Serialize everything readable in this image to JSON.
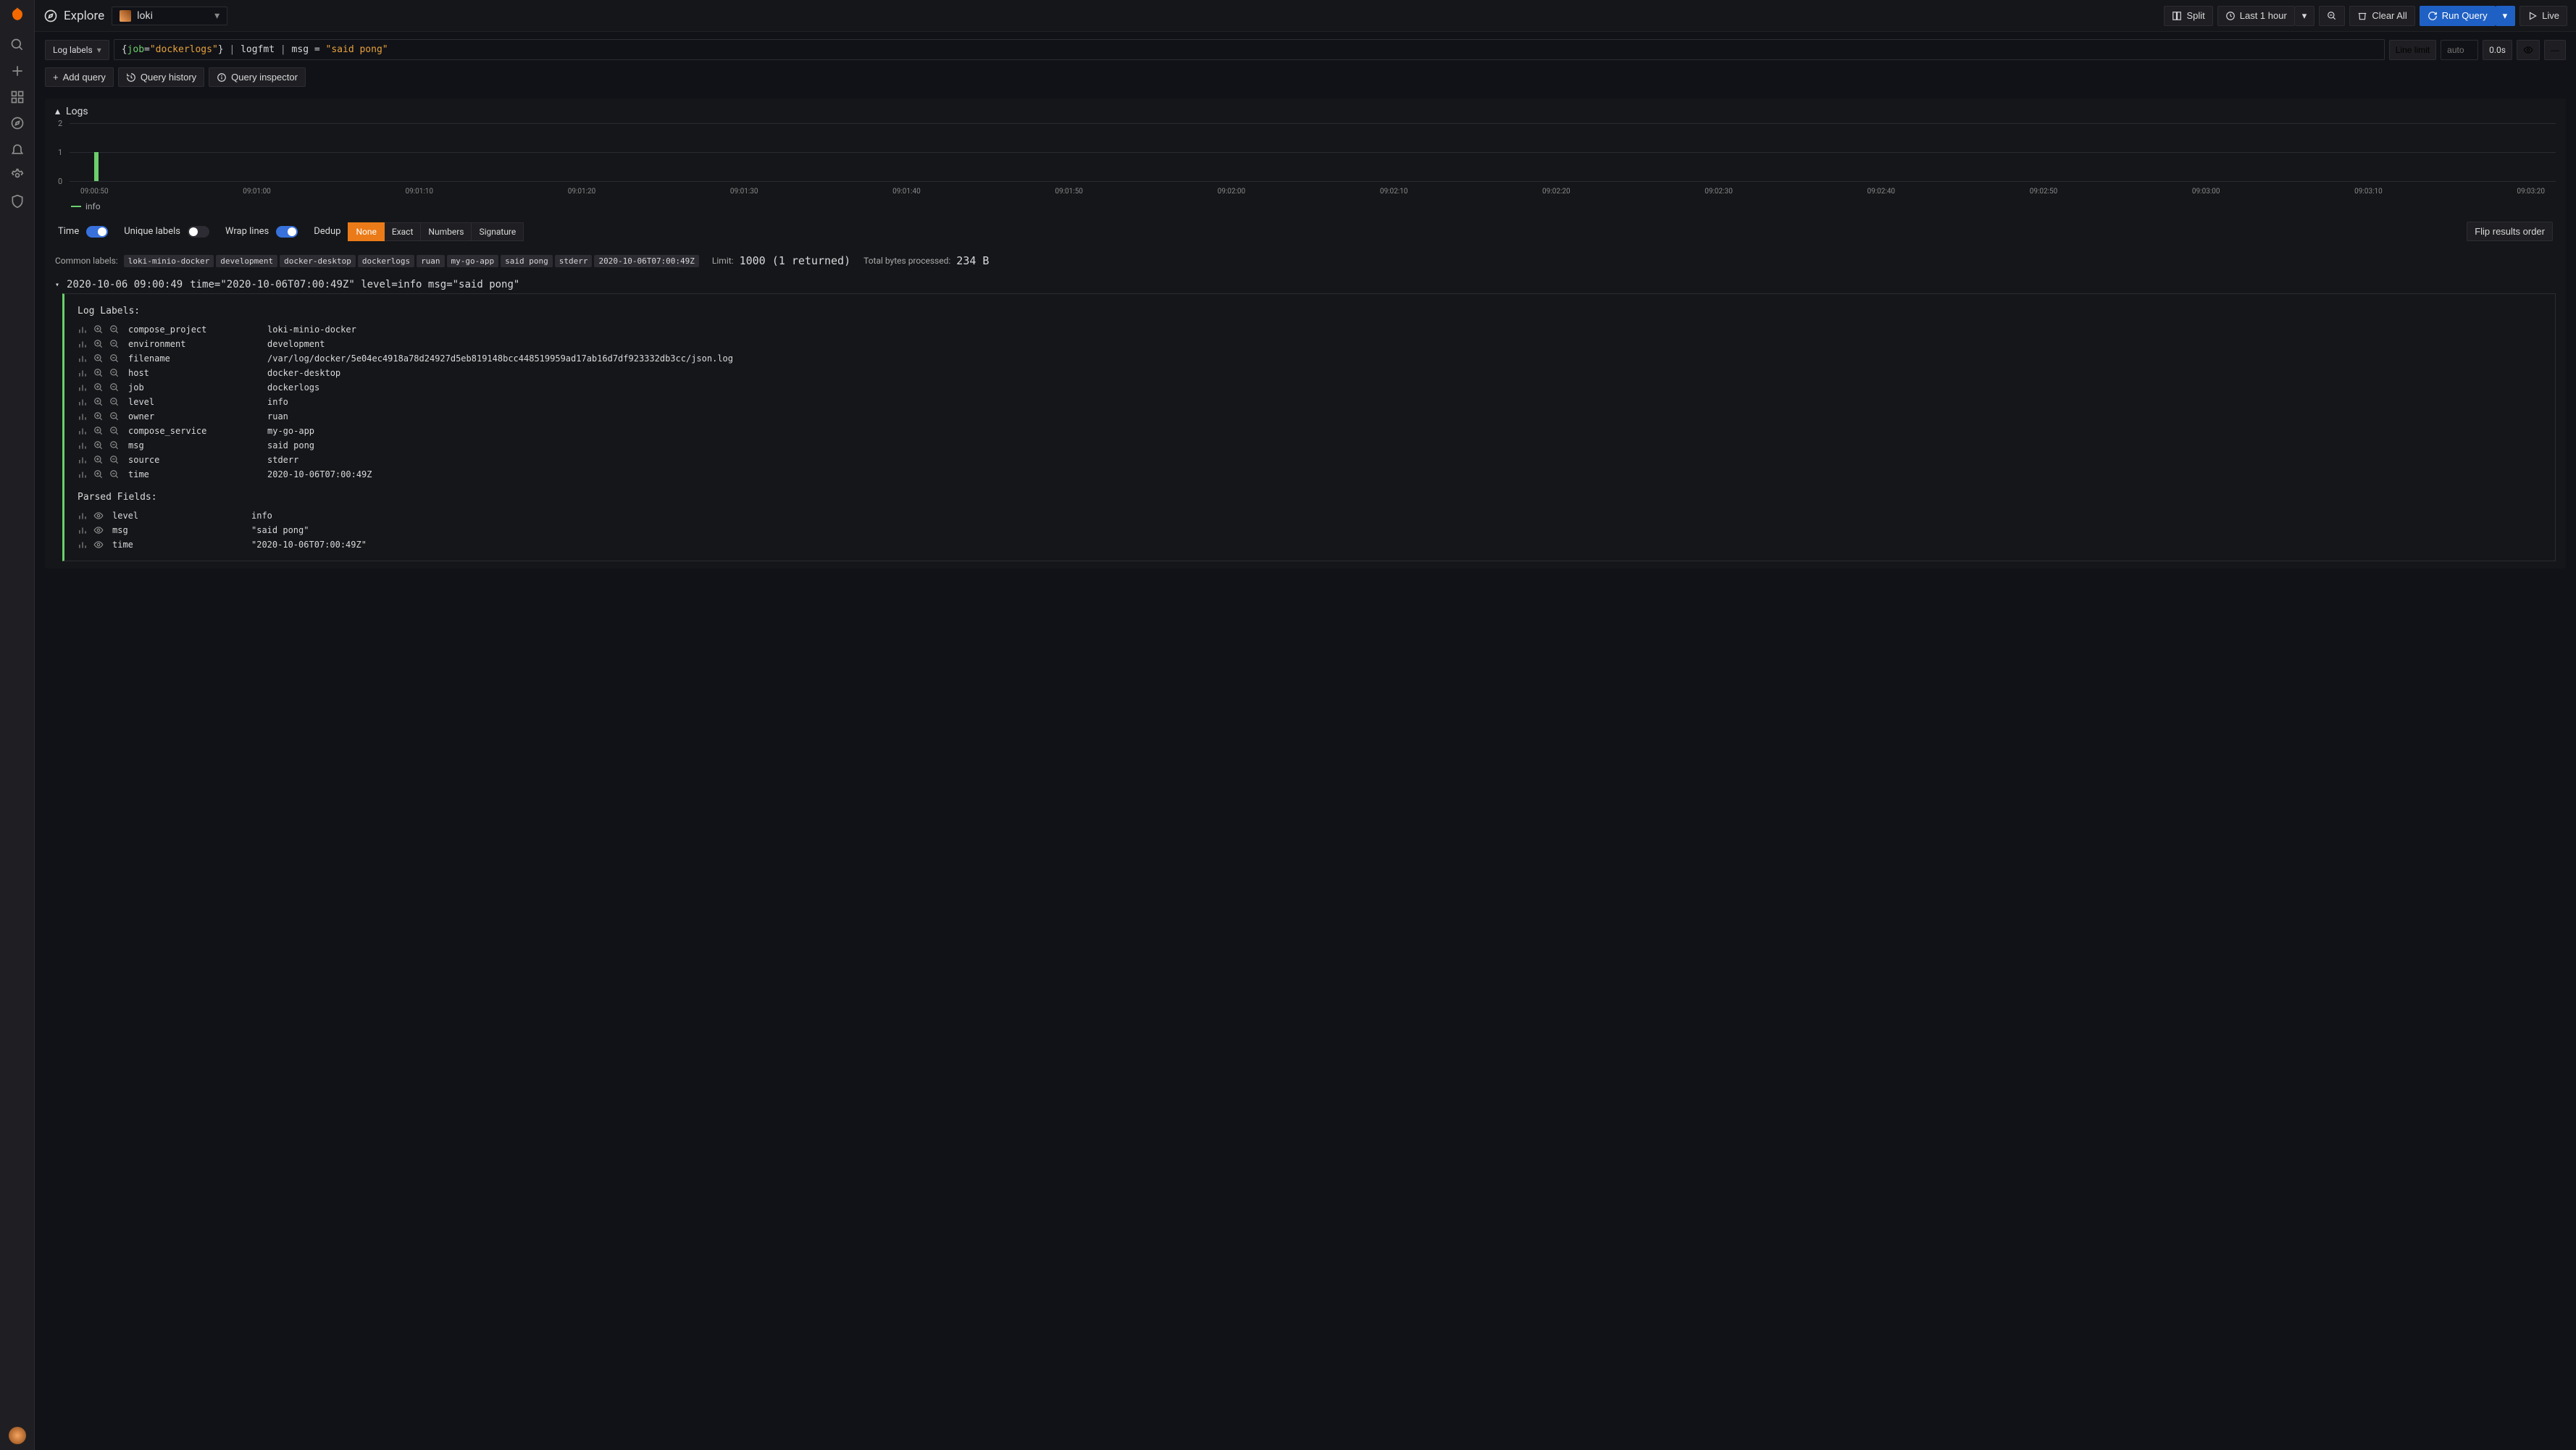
{
  "header": {
    "title": "Explore",
    "datasource": "loki",
    "split": "Split",
    "timerange": "Last 1 hour",
    "clear": "Clear All",
    "run": "Run Query",
    "live": "Live"
  },
  "query": {
    "mode": "Log labels",
    "expr_html": "<span class='p'>{</span><span class='k'>job</span><span class='p'>=</span><span class='s'>\"dockerlogs\"</span><span class='p'>}</span> <span class='op'>|</span> logfmt <span class='op'>|</span> msg = <span class='s'>\"said pong\"</span>",
    "line_limit": "Line limit",
    "auto_placeholder": "auto",
    "duration": "0.0s",
    "add_query": "Add query",
    "history": "Query history",
    "inspector": "Query inspector"
  },
  "panel": {
    "title": "Logs"
  },
  "chart_data": {
    "type": "bar",
    "categories": [
      "09:00:50",
      "09:01:00",
      "09:01:10",
      "09:01:20",
      "09:01:30",
      "09:01:40",
      "09:01:50",
      "09:02:00",
      "09:02:10",
      "09:02:20",
      "09:02:30",
      "09:02:40",
      "09:02:50",
      "09:03:00",
      "09:03:10",
      "09:03:20"
    ],
    "series": [
      {
        "name": "info",
        "values": [
          1,
          0,
          0,
          0,
          0,
          0,
          0,
          0,
          0,
          0,
          0,
          0,
          0,
          0,
          0,
          0
        ]
      }
    ],
    "ylabel": "",
    "ylim": [
      0,
      2
    ],
    "yticks": [
      0,
      1,
      2
    ],
    "legend": [
      "info"
    ]
  },
  "controls": {
    "time": {
      "label": "Time",
      "on": true
    },
    "unique": {
      "label": "Unique labels",
      "on": false
    },
    "wrap": {
      "label": "Wrap lines",
      "on": true
    },
    "dedup": {
      "label": "Dedup",
      "options": [
        "None",
        "Exact",
        "Numbers",
        "Signature"
      ],
      "active": "None"
    },
    "flip": "Flip results order"
  },
  "common_labels": {
    "label": "Common labels:",
    "tags": [
      "loki-minio-docker",
      "development",
      "docker-desktop",
      "dockerlogs",
      "ruan",
      "my-go-app",
      "said pong",
      "stderr",
      "2020-10-06T07:00:49Z"
    ],
    "limit_label": "Limit:",
    "limit_value": "1000 (1 returned)",
    "bytes_label": "Total bytes processed:",
    "bytes_value": "234  B"
  },
  "logline": {
    "ts": "2020-10-06 09:00:49",
    "msg": "time=\"2020-10-06T07:00:49Z\" level=info msg=\"said pong\""
  },
  "details": {
    "labels_header": "Log Labels:",
    "labels": [
      {
        "key": "compose_project",
        "val": "loki-minio-docker"
      },
      {
        "key": "environment",
        "val": "development"
      },
      {
        "key": "filename",
        "val": "/var/log/docker/5e04ec4918a78d24927d5eb819148bcc448519959ad17ab16d7df923332db3cc/json.log"
      },
      {
        "key": "host",
        "val": "docker-desktop"
      },
      {
        "key": "job",
        "val": "dockerlogs"
      },
      {
        "key": "level",
        "val": "info"
      },
      {
        "key": "owner",
        "val": "ruan"
      },
      {
        "key": "compose_service",
        "val": "my-go-app"
      },
      {
        "key": "msg",
        "val": "said pong"
      },
      {
        "key": "source",
        "val": "stderr"
      },
      {
        "key": "time",
        "val": "2020-10-06T07:00:49Z"
      }
    ],
    "parsed_header": "Parsed Fields:",
    "parsed": [
      {
        "key": "level",
        "val": "info"
      },
      {
        "key": "msg",
        "val": "\"said pong\""
      },
      {
        "key": "time",
        "val": "\"2020-10-06T07:00:49Z\""
      }
    ]
  }
}
